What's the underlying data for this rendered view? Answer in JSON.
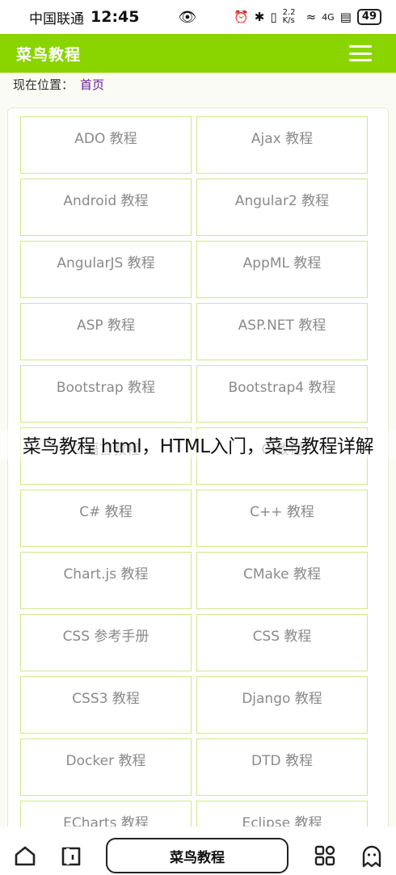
{
  "status_bar": {
    "carrier": "中国联通",
    "time": "12:45",
    "speed": "2.2 K/s",
    "network": "4G",
    "battery": "49"
  },
  "header": {
    "title": "菜鸟教程"
  },
  "breadcrumb": {
    "label": "现在位置：",
    "home": "首页"
  },
  "courses": [
    "ADO 教程",
    "Ajax 教程",
    "Android 教程",
    "Angular2 教程",
    "AngularJS 教程",
    "AppML 教程",
    "ASP 教程",
    "ASP.NET 教程",
    "Bootstrap 教程",
    "Bootstrap4 教程",
    "C 语言教程",
    "C 教程",
    "C# 教程",
    "C++ 教程",
    "Chart.js 教程",
    "CMake 教程",
    "CSS 参考手册",
    "CSS 教程",
    "CSS3 教程",
    "Django 教程",
    "Docker 教程",
    "DTD 教程",
    "ECharts 教程",
    "Eclipse 教程"
  ],
  "overlay_caption": "菜鸟教程 html，HTML入门，菜鸟教程详解",
  "bottom_bar": {
    "center_label": "菜鸟教程"
  },
  "colors": {
    "brand": "#8ad400",
    "card_border": "#cfe88a",
    "link": "#6a1b9a"
  }
}
